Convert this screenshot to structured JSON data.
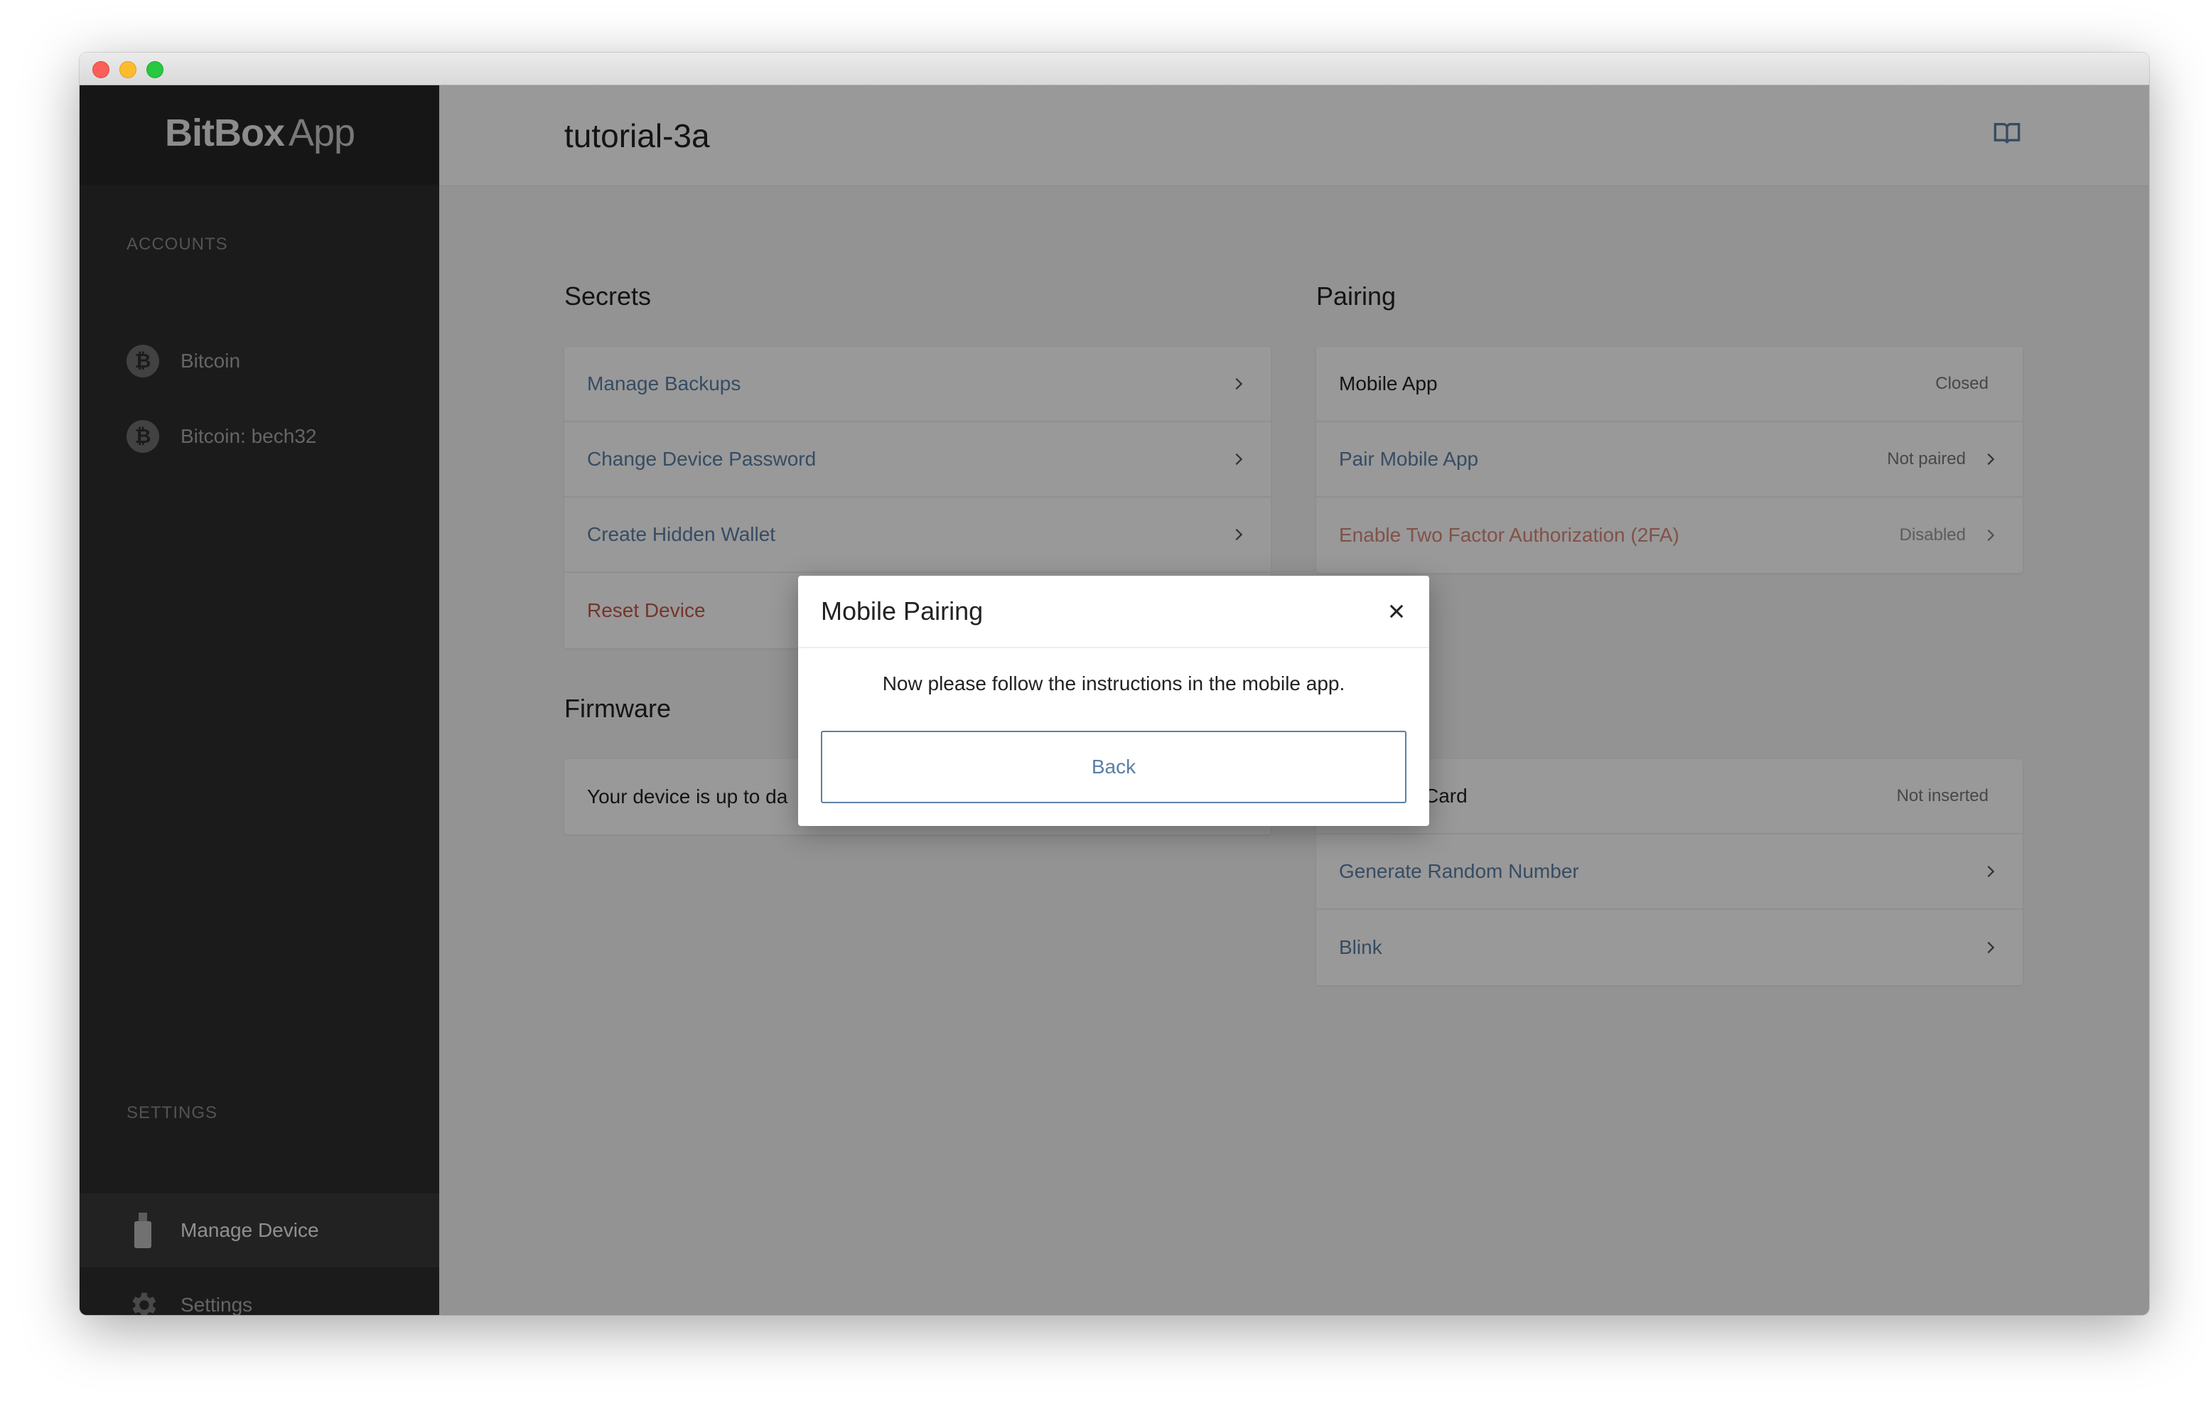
{
  "app": {
    "logo_bold": "BitBox",
    "logo_light": "App"
  },
  "sidebar": {
    "accounts_label": "ACCOUNTS",
    "accounts": [
      {
        "label": "Bitcoin",
        "icon": "bitcoin-icon"
      },
      {
        "label": "Bitcoin: bech32",
        "icon": "bitcoin-icon"
      }
    ],
    "settings_label": "SETTINGS",
    "settings_items": [
      {
        "label": "Manage Device",
        "icon": "usb-stick-icon",
        "active": true
      },
      {
        "label": "Settings",
        "icon": "gear-icon",
        "active": false
      }
    ]
  },
  "header": {
    "title": "tutorial-3a",
    "guide_icon": "book-icon"
  },
  "secrets": {
    "title": "Secrets",
    "rows": [
      {
        "label": "Manage Backups"
      },
      {
        "label": "Change Device Password"
      },
      {
        "label": "Create Hidden Wallet"
      },
      {
        "label": "Reset Device"
      }
    ]
  },
  "pairing": {
    "title": "Pairing",
    "rows": [
      {
        "label": "Mobile App",
        "status": "Closed"
      },
      {
        "label": "Pair Mobile App",
        "status": "Not paired"
      },
      {
        "label": "Enable Two Factor Authorization (2FA)",
        "status": "Disabled"
      }
    ]
  },
  "firmware": {
    "title": "Firmware",
    "rows": [
      {
        "label": "Your device is up to da"
      }
    ]
  },
  "hardware": {
    "rows": [
      {
        "label": "Card",
        "status": "Not inserted"
      },
      {
        "label": "Generate Random Number"
      },
      {
        "label": "Blink"
      }
    ]
  },
  "modal": {
    "title": "Mobile Pairing",
    "message": "Now please follow the instructions in the mobile app.",
    "back_label": "Back"
  },
  "colors": {
    "link": "#5b7fa6",
    "danger": "#c25a4a",
    "sidebar_bg": "#2d2d2d"
  }
}
